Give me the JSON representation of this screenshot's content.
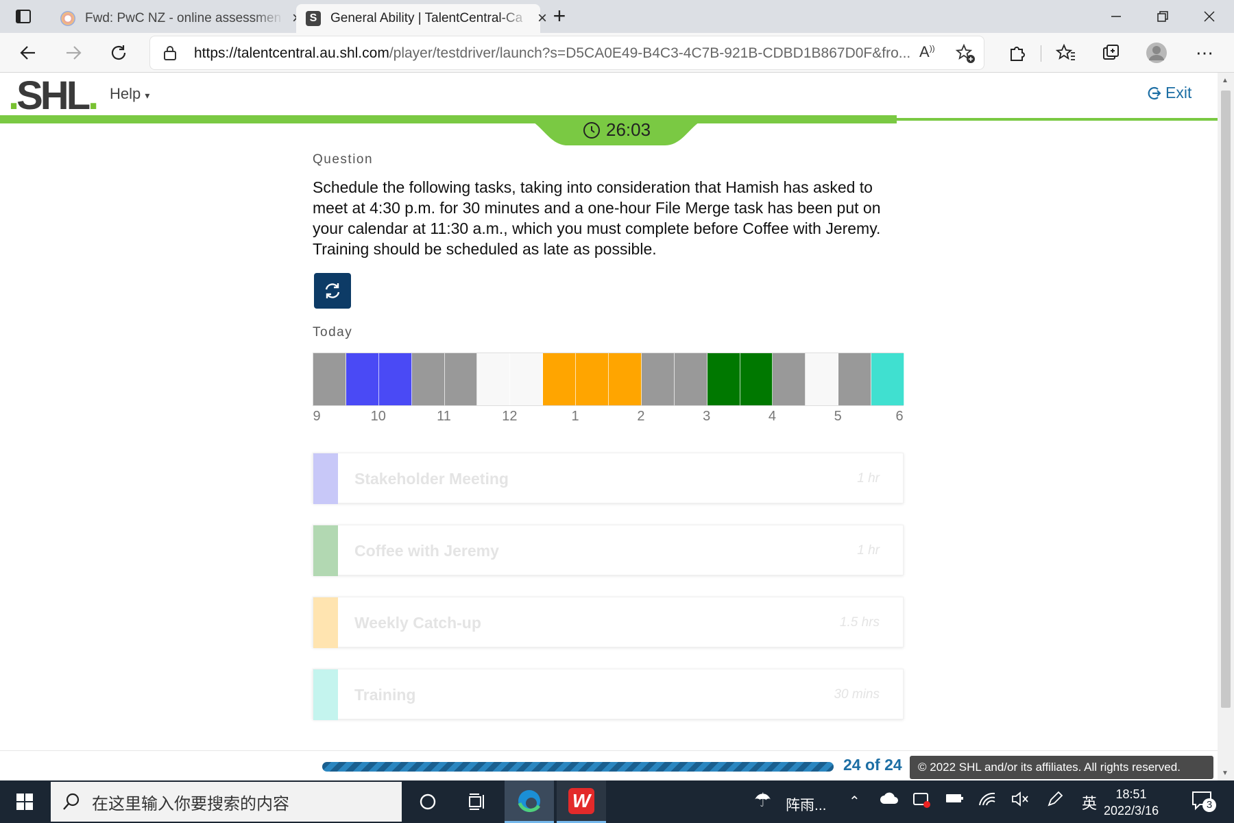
{
  "browser": {
    "tabs": [
      {
        "title": "Fwd: PwC NZ - online assessmen",
        "active": false
      },
      {
        "title": "General Ability | TalentCentral-Ca",
        "active": true
      }
    ],
    "url_domain": "https://talentcentral.au.shl.com",
    "url_rest": "/player/testdriver/launch?s=D5CA0E49-B4C3-4C7B-921B-CDBD1B867D0F&fro..."
  },
  "app": {
    "logo": ".SHL.",
    "help_label": "Help",
    "exit_label": "Exit",
    "timer": "26:03",
    "colors": {
      "brand_green": "#7ac943",
      "accent_blue": "#1c6ea4",
      "button_navy": "#0d3b66"
    }
  },
  "question": {
    "heading": "Question",
    "text": "Schedule the following tasks, taking into consideration that Hamish has asked to meet at 4:30 p.m. for 30 minutes and a one-hour File Merge task has been put on your calendar at 11:30 a.m., which you must complete before Coffee with Jeremy. Training should be scheduled as late as possible."
  },
  "schedule": {
    "heading": "Today",
    "slot_colors": [
      "#999999",
      "#4a4af5",
      "#4a4af5",
      "#999999",
      "#999999",
      "#f8f8f8",
      "#f8f8f8",
      "#ffa500",
      "#ffa500",
      "#ffa500",
      "#999999",
      "#999999",
      "#007800",
      "#007800",
      "#999999",
      "#f8f8f8",
      "#999999",
      "#40e0d0"
    ],
    "hour_labels": [
      "9",
      "10",
      "11",
      "12",
      "1",
      "2",
      "3",
      "4",
      "5",
      "6"
    ]
  },
  "tasks": [
    {
      "name": "Stakeholder Meeting",
      "duration": "1 hr",
      "color": "#c8c8f8"
    },
    {
      "name": "Coffee with Jeremy",
      "duration": "1 hr",
      "color": "#b2d8b2"
    },
    {
      "name": "Weekly Catch-up",
      "duration": "1.5 hrs",
      "color": "#ffe4b0"
    },
    {
      "name": "Training",
      "duration": "30 mins",
      "color": "#c4f4ee"
    }
  ],
  "footer": {
    "progress": 1.0,
    "page_count": "24 of 24",
    "copyright": "© 2022 SHL and/or its affiliates. All rights reserved."
  },
  "taskbar": {
    "search_placeholder": "在这里输入你要搜索的内容",
    "weather": "阵雨...",
    "ime": "英",
    "time": "18:51",
    "date": "2022/3/16",
    "notifications": "3"
  }
}
